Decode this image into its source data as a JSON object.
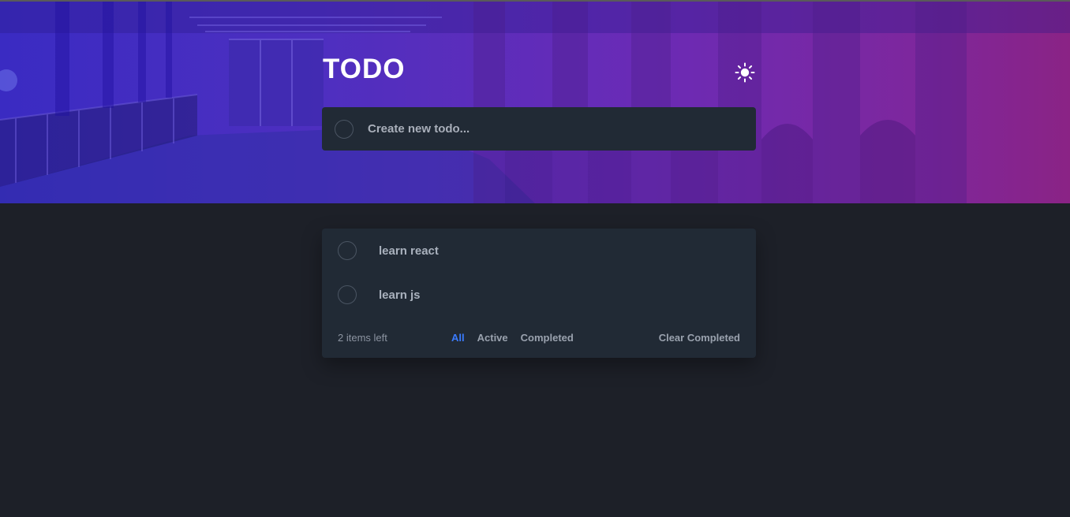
{
  "app": {
    "title": "TODO",
    "theme_icon": "sun-icon"
  },
  "new_todo": {
    "placeholder": "Create new todo...",
    "value": ""
  },
  "todos": [
    {
      "text": "learn react",
      "completed": false
    },
    {
      "text": "learn js",
      "completed": false
    }
  ],
  "footer": {
    "items_left": "2 items left",
    "filters": [
      {
        "label": "All",
        "active": true
      },
      {
        "label": "Active",
        "active": false
      },
      {
        "label": "Completed",
        "active": false
      }
    ],
    "clear_label": "Clear Completed"
  },
  "colors": {
    "background": "#1d2028",
    "card": "#212a35",
    "accent": "#3a7bfd",
    "gradient_start": "#3a2bc2",
    "gradient_end": "#8a2385"
  }
}
